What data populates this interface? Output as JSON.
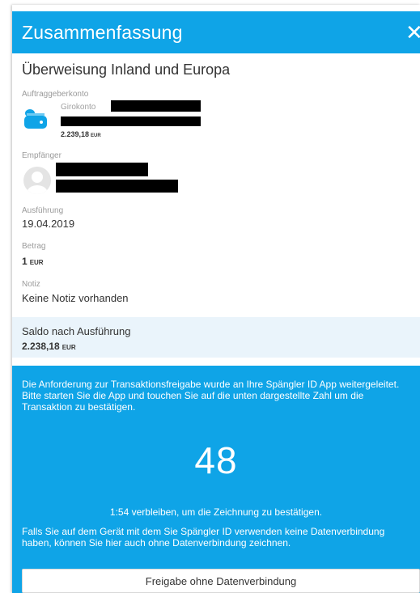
{
  "header": {
    "title": "Zusammenfassung",
    "close_glyph": "✕"
  },
  "transfer_type": "Überweisung Inland und Europa",
  "account": {
    "label": "Auftraggeberkonto",
    "name": "Girokonto",
    "balance": "2.239,18",
    "currency": "EUR",
    "icon": "wallet-icon",
    "icon_color": "#0fa4e7"
  },
  "recipient": {
    "label": "Empfänger",
    "icon": "avatar-icon"
  },
  "execution": {
    "label": "Ausführung",
    "value": "19.04.2019"
  },
  "amount": {
    "label": "Betrag",
    "value": "1",
    "currency": "EUR"
  },
  "note": {
    "label": "Notiz",
    "value": "Keine Notiz vorhanden"
  },
  "saldo": {
    "label": "Saldo nach Ausführung",
    "value": "2.238,18",
    "currency": "EUR"
  },
  "approval": {
    "info": "Die Anforderung zur Transaktionsfreigabe wurde an Ihre Spängler ID App weitergeleitet. Bitte starten Sie die App und touchen Sie auf die unten dargestellte Zahl um die Transaktion zu bestätigen.",
    "code": "48",
    "countdown": "1:54 verbleiben, um die Zeichnung zu bestätigen.",
    "offline_hint": "Falls Sie auf dem Gerät mit dem Sie Spängler ID verwenden keine Datenverbindung haben, können Sie hier auch ohne Datenverbindung zeichnen.",
    "offline_button": "Freigabe ohne Datenverbindung"
  },
  "colors": {
    "accent": "#0fa4e7",
    "saldo_background": "#eaf4fb"
  }
}
